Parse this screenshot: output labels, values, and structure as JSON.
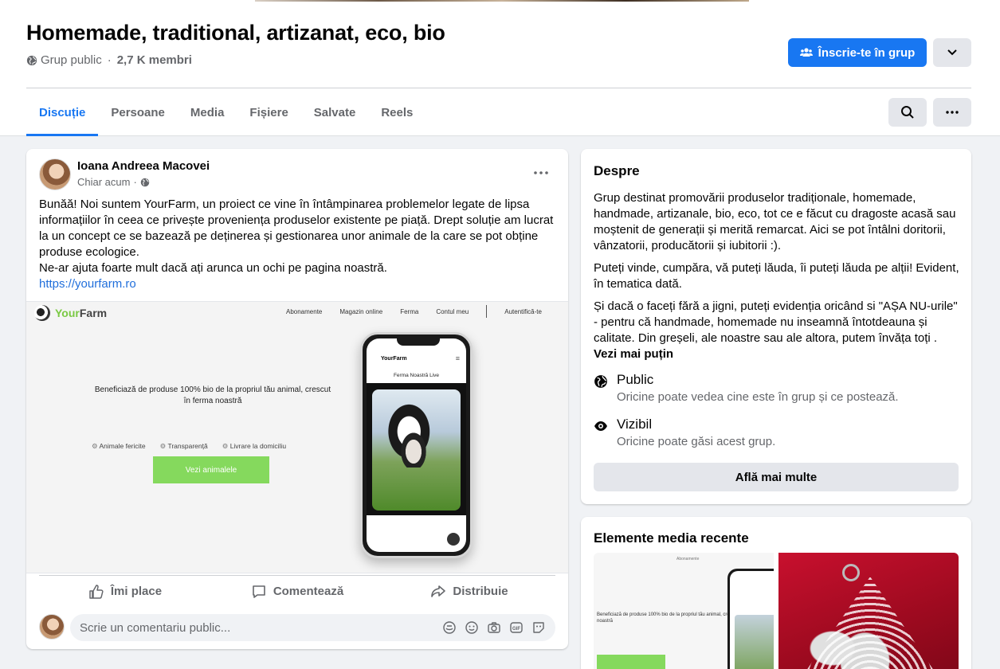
{
  "group": {
    "title": "Homemade, traditional, artizanat, eco, bio",
    "privacy": "Grup public",
    "separator": "·",
    "members": "2,7 K membri",
    "join_label": "Înscrie-te în grup"
  },
  "tabs": [
    {
      "label": "Discuție",
      "active": true
    },
    {
      "label": "Persoane"
    },
    {
      "label": "Media"
    },
    {
      "label": "Fișiere"
    },
    {
      "label": "Salvate"
    },
    {
      "label": "Reels"
    }
  ],
  "post": {
    "author": "Ioana Andreea Macovei",
    "time": "Chiar acum",
    "text_1": "Bunăă! Noi suntem YourFarm, un proiect ce vine în întâmpinarea problemelor legate de lipsa informațiilor în ceea ce privește proveniența produselor existente pe piață. Drept soluție am lucrat la un concept ce se bazează pe deținerea și gestionarea unor animale de la care se pot obține produse ecologice.",
    "text_2": "Ne-ar ajuta foarte mult dacă ați arunca un ochi pe pagina noastră.",
    "link": "https://yourfarm.ro",
    "preview": {
      "logo_your": "Your",
      "logo_farm": "Farm",
      "nav": [
        "Abonamente",
        "Magazin online",
        "Ferma",
        "Contul meu",
        "Autentifică-te"
      ],
      "tagline": "Beneficiază de produse 100% bio de la propriul tău animal, crescut în ferma noastră",
      "features": [
        "Animale fericite",
        "Transparență",
        "Livrare la domiciliu"
      ],
      "cta": "Vezi animalele",
      "phone_logo": "YourFarm",
      "phone_title": "Ferma Noastră Live"
    },
    "actions": {
      "like": "Îmi place",
      "comment": "Comentează",
      "share": "Distribuie"
    },
    "comment_placeholder": "Scrie un comentariu public..."
  },
  "about": {
    "title": "Despre",
    "para_1": "Grup destinat promovării produselor tradiționale, homemade, handmade, artizanale, bio, eco, tot ce e făcut cu dragoste acasă sau moștenit de generații și merită remarcat. Aici se pot întâlni doritorii, vânzatorii, producătorii și iubitorii :).",
    "para_2": "Puteți vinde, cumpăra, vă puteți lăuda, îi puteți lăuda pe alții! Evident, în tematica dată.",
    "para_3": "Și dacă o faceți fără a jigni, puteți evidenția oricând si \"AȘA NU-urile\" - pentru că handmade, homemade nu inseamnă întotdeauna și calitate. Din greșeli, ale noastre sau ale altora, putem învăța toți .",
    "see_less": "Vezi mai puțin",
    "public_title": "Public",
    "public_desc": "Oricine poate vedea cine este în grup și ce postează.",
    "visible_title": "Vizibil",
    "visible_desc": "Oricine poate găsi acest grup.",
    "learn_more": "Află mai multe"
  },
  "media": {
    "title": "Elemente media recente"
  },
  "colors": {
    "accent": "#1877f2",
    "secondary_text": "#65676b",
    "button_gray": "#e4e6eb",
    "yourfarm_green": "#85d95d"
  },
  "icons": [
    "globe-icon",
    "people-icon",
    "chevron-down-icon",
    "search-icon",
    "more-icon",
    "like-icon",
    "comment-icon",
    "share-icon",
    "eye-icon"
  ]
}
